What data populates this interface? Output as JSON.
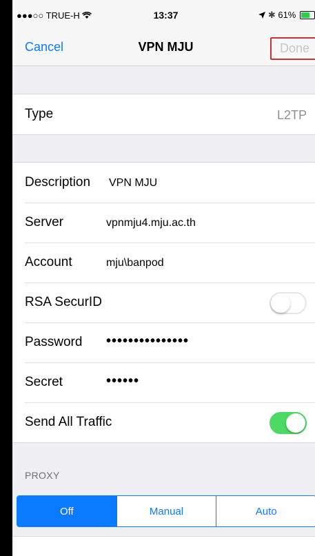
{
  "status": {
    "carrier": "●●●○○ TRUE-H ",
    "time": "13:37",
    "battery_text": "61%",
    "signal_icon": "wifi-icon",
    "location_icon": "location-arrow-icon",
    "bluetooth_icon": "bluetooth-icon"
  },
  "nav": {
    "cancel": "Cancel",
    "title": "VPN MJU",
    "done": "Done"
  },
  "type_row": {
    "label": "Type",
    "value": "L2TP"
  },
  "fields": {
    "description_label": "Description",
    "description_value": "VPN MJU",
    "server_label": "Server",
    "server_value": "vpnmju4.mju.ac.th",
    "account_label": "Account",
    "account_value": "mju\\banpod",
    "rsa_label": "RSA SecurID",
    "rsa_on": false,
    "password_label": "Password",
    "password_value": "•••••••••••••••",
    "secret_label": "Secret",
    "secret_value": "••••••",
    "sendall_label": "Send All Traffic",
    "sendall_on": true
  },
  "proxy": {
    "header": "PROXY",
    "options": [
      "Off",
      "Manual",
      "Auto"
    ],
    "selected": "Off"
  },
  "colors": {
    "accent": "#0a7aff",
    "toggle_on": "#4cd964",
    "done_disabled": "#c8c8cc",
    "highlight_border": "#c83232"
  }
}
